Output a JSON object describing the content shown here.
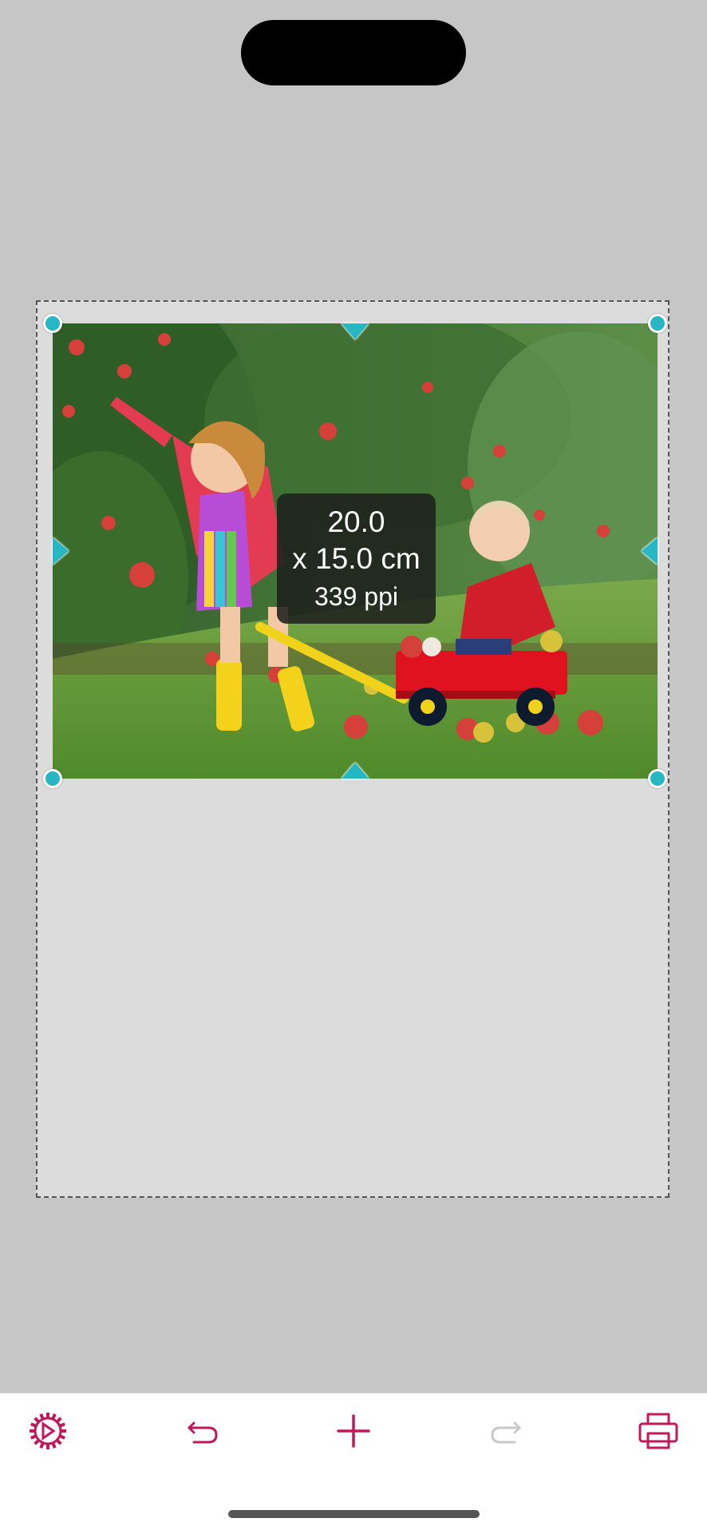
{
  "status_bar": {
    "dynamic_island": ""
  },
  "print_page": {
    "photo": {
      "description_icon": "photo-girl-pulling-wagon-apple-orchard-icon"
    },
    "size_overlay": {
      "width_text": "20.0",
      "height_text": "x 15.0 cm",
      "resolution_text": "339 ppi"
    },
    "handle_color": "#27b7c4"
  },
  "toolbar": {
    "accent_color": "#c2185b",
    "disabled_color": "#c8c8c8",
    "items": [
      {
        "icon": "settings-gear-icon",
        "enabled": true
      },
      {
        "icon": "undo-icon",
        "enabled": true
      },
      {
        "icon": "add-plus-icon",
        "enabled": true
      },
      {
        "icon": "redo-icon",
        "enabled": false
      },
      {
        "icon": "printer-icon",
        "enabled": true
      }
    ]
  }
}
